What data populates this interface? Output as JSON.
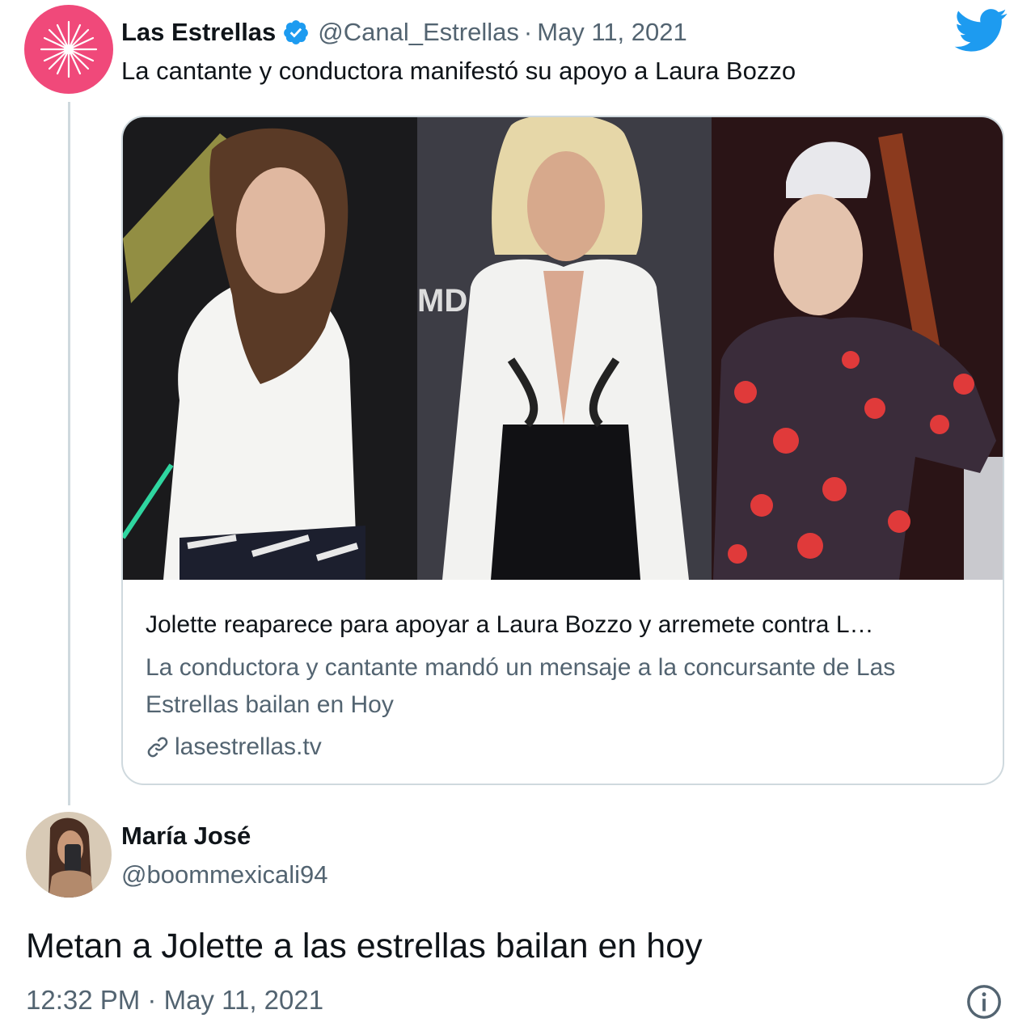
{
  "parent_tweet": {
    "display_name": "Las Estrellas",
    "handle": "@Canal_Estrellas",
    "separator": "·",
    "date": "May 11, 2021",
    "text": "La cantante y conductora manifestó su apoyo a Laura Bozzo",
    "avatar_icon": "star-burst-logo",
    "verified_icon": "verified-badge-icon",
    "brand_icon": "twitter-bird-icon",
    "colors": {
      "avatar": "#f0497a",
      "verified": "#1d9bf0",
      "twitter_blue": "#1d9bf0"
    }
  },
  "card": {
    "image_description_icon": "three-women-photo-collage",
    "title": "Jolette reaparece para apoyar a Laura Bozzo y arremete contra L…",
    "description": "La conductora y cantante mandó un mensaje a la concursante de Las Estrellas bailan en Hoy",
    "domain": "lasestrellas.tv",
    "link_icon": "link-icon"
  },
  "reply_tweet": {
    "display_name": "María José",
    "handle": "@boommexicali94",
    "text": "Metan a Jolette a las estrellas bailan en hoy",
    "timestamp": "12:32 PM · May 11, 2021",
    "info_icon": "info-icon"
  }
}
